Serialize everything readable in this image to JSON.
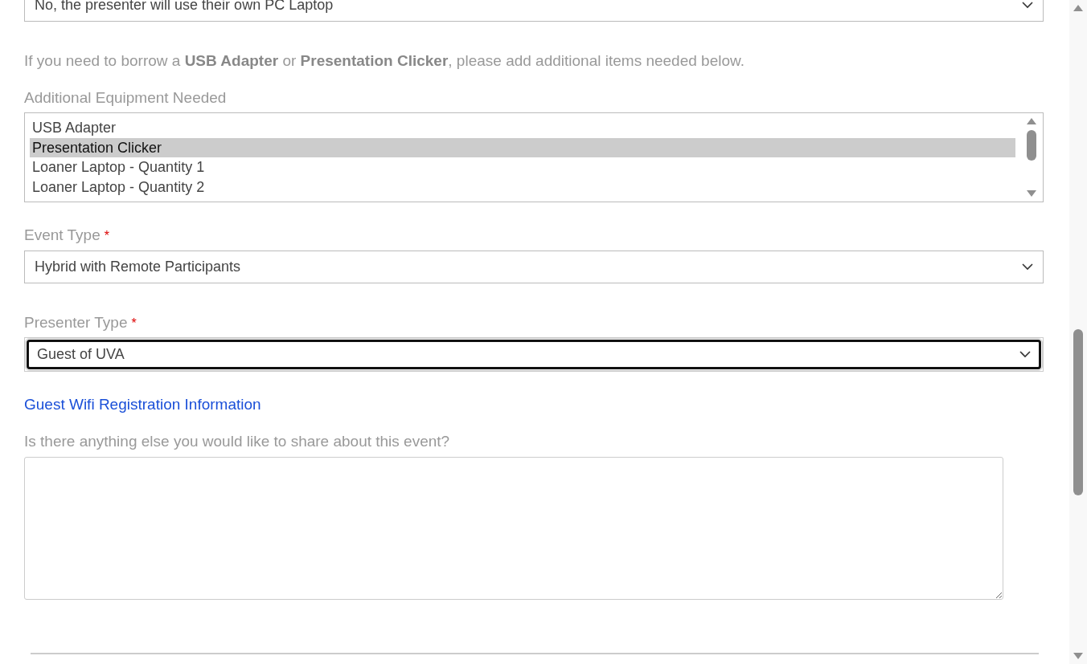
{
  "laptop_select": {
    "value": "No, the presenter will use their own PC Laptop"
  },
  "info_text": "If you need to borrow a **USB Adapter** or **Presentation Clicker**, please add additional items needed below.",
  "equipment": {
    "label": "Additional Equipment Needed",
    "options": [
      {
        "label": "USB Adapter",
        "selected": false
      },
      {
        "label": "Presentation Clicker",
        "selected": true
      },
      {
        "label": "Loaner Laptop - Quantity 1",
        "selected": false
      },
      {
        "label": "Loaner Laptop - Quantity 2",
        "selected": false
      }
    ]
  },
  "event_type": {
    "label": "Event Type",
    "required_mark": "*",
    "value": "Hybrid with Remote Participants",
    "focused": false
  },
  "presenter_type": {
    "label": "Presenter Type",
    "required_mark": "*",
    "value": "Guest of UVA",
    "focused": true
  },
  "guest_wifi_link": "Guest Wifi Registration Information",
  "share": {
    "label": "Is there anything else you would like to share about this event?"
  }
}
